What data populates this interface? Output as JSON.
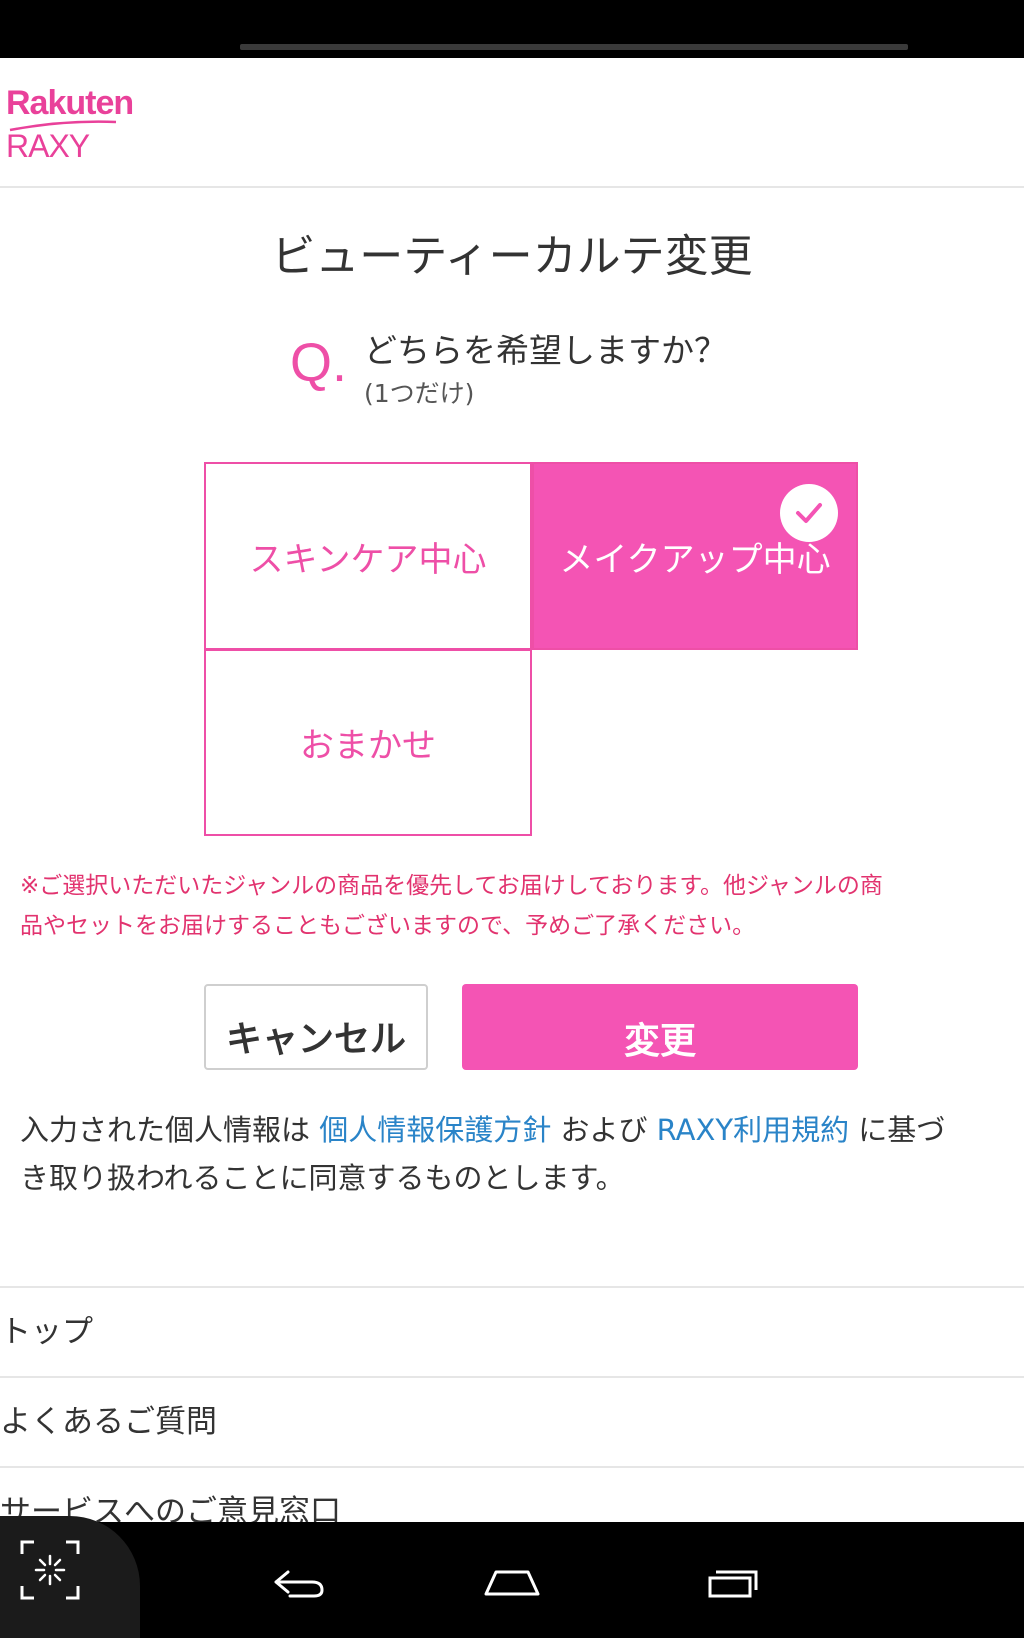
{
  "header": {
    "logo_brand": "Rakuten",
    "logo_product": "RAXY"
  },
  "page": {
    "title": "ビューティーカルテ変更"
  },
  "question": {
    "mark": "Q.",
    "text": "どちらを希望しますか？",
    "note": "(1つだけ)"
  },
  "options": [
    {
      "label": "スキンケア中心",
      "selected": false
    },
    {
      "label": "メイクアップ中心",
      "selected": true
    },
    {
      "label": "おまかせ",
      "selected": false
    }
  ],
  "notice": {
    "line1": "※ご選択いただいたジャンルの商品を優先してお届けしております。他ジャンルの商",
    "line2": "品やセットをお届けすることもございますので、予めご了承ください。"
  },
  "buttons": {
    "cancel": "キャンセル",
    "submit": "変更"
  },
  "consent": {
    "prefix": "入力された個人情報は ",
    "link_privacy": "個人情報保護方針",
    "middle": " および ",
    "link_terms": "RAXY利用規約",
    "suffix": " に基づ",
    "line2": "き取り扱われることに同意するものとします。"
  },
  "footer_nav": [
    "トップ",
    "よくあるご質問",
    "サービスへのご意見窓口"
  ],
  "colors": {
    "brand_pink": "#ee4fa7",
    "selected_fill": "#f454b4",
    "notice_red": "#e2336f",
    "link_blue": "#2a84c8"
  },
  "icons": {
    "selected_check": "check-circle-icon",
    "android_back": "back-icon",
    "android_home": "home-icon",
    "android_recents": "recents-icon",
    "screenshot": "screenshot-icon"
  }
}
